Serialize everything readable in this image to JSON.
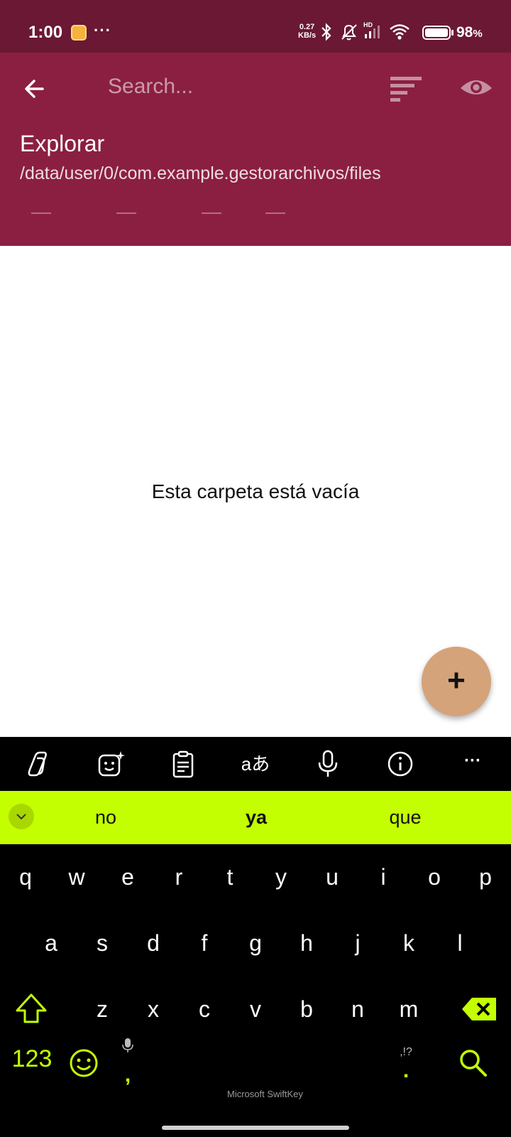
{
  "status_bar": {
    "time": "1:00",
    "more_indicator": "···",
    "net_speed_value": "0.27",
    "net_speed_unit": "KB/s",
    "battery": "98",
    "battery_unit": "%",
    "hd_label": "HD",
    "background_color": "#6a1834"
  },
  "header": {
    "search_placeholder": "Search...",
    "title": "Explorar",
    "path": "/data/user/0/com.example.gestorarchivos/files",
    "background_color": "#8b1f42"
  },
  "content": {
    "empty_message": "Esta carpeta está vacía"
  },
  "fab": {
    "label": "+",
    "color": "#d5a37a"
  },
  "keyboard": {
    "toolbar_icons": [
      "copilot-icon",
      "sticker-icon",
      "clipboard-icon",
      "translate-icon",
      "microphone-icon",
      "info-icon",
      "more-icon"
    ],
    "translate_label": "aあ",
    "more_label": "···",
    "suggestions": [
      "no",
      "ya",
      "que"
    ],
    "row1": [
      "q",
      "w",
      "e",
      "r",
      "t",
      "y",
      "u",
      "i",
      "o",
      "p"
    ],
    "row2": [
      "a",
      "s",
      "d",
      "f",
      "g",
      "h",
      "j",
      "k",
      "l"
    ],
    "row3": [
      "z",
      "x",
      "c",
      "v",
      "b",
      "n",
      "m"
    ],
    "numbers_label": "123",
    "comma_label": ",",
    "period_label": ".",
    "punct_hint": ",!?",
    "space_label": "Microsoft SwiftKey",
    "accent_color": "#c3ff00"
  }
}
